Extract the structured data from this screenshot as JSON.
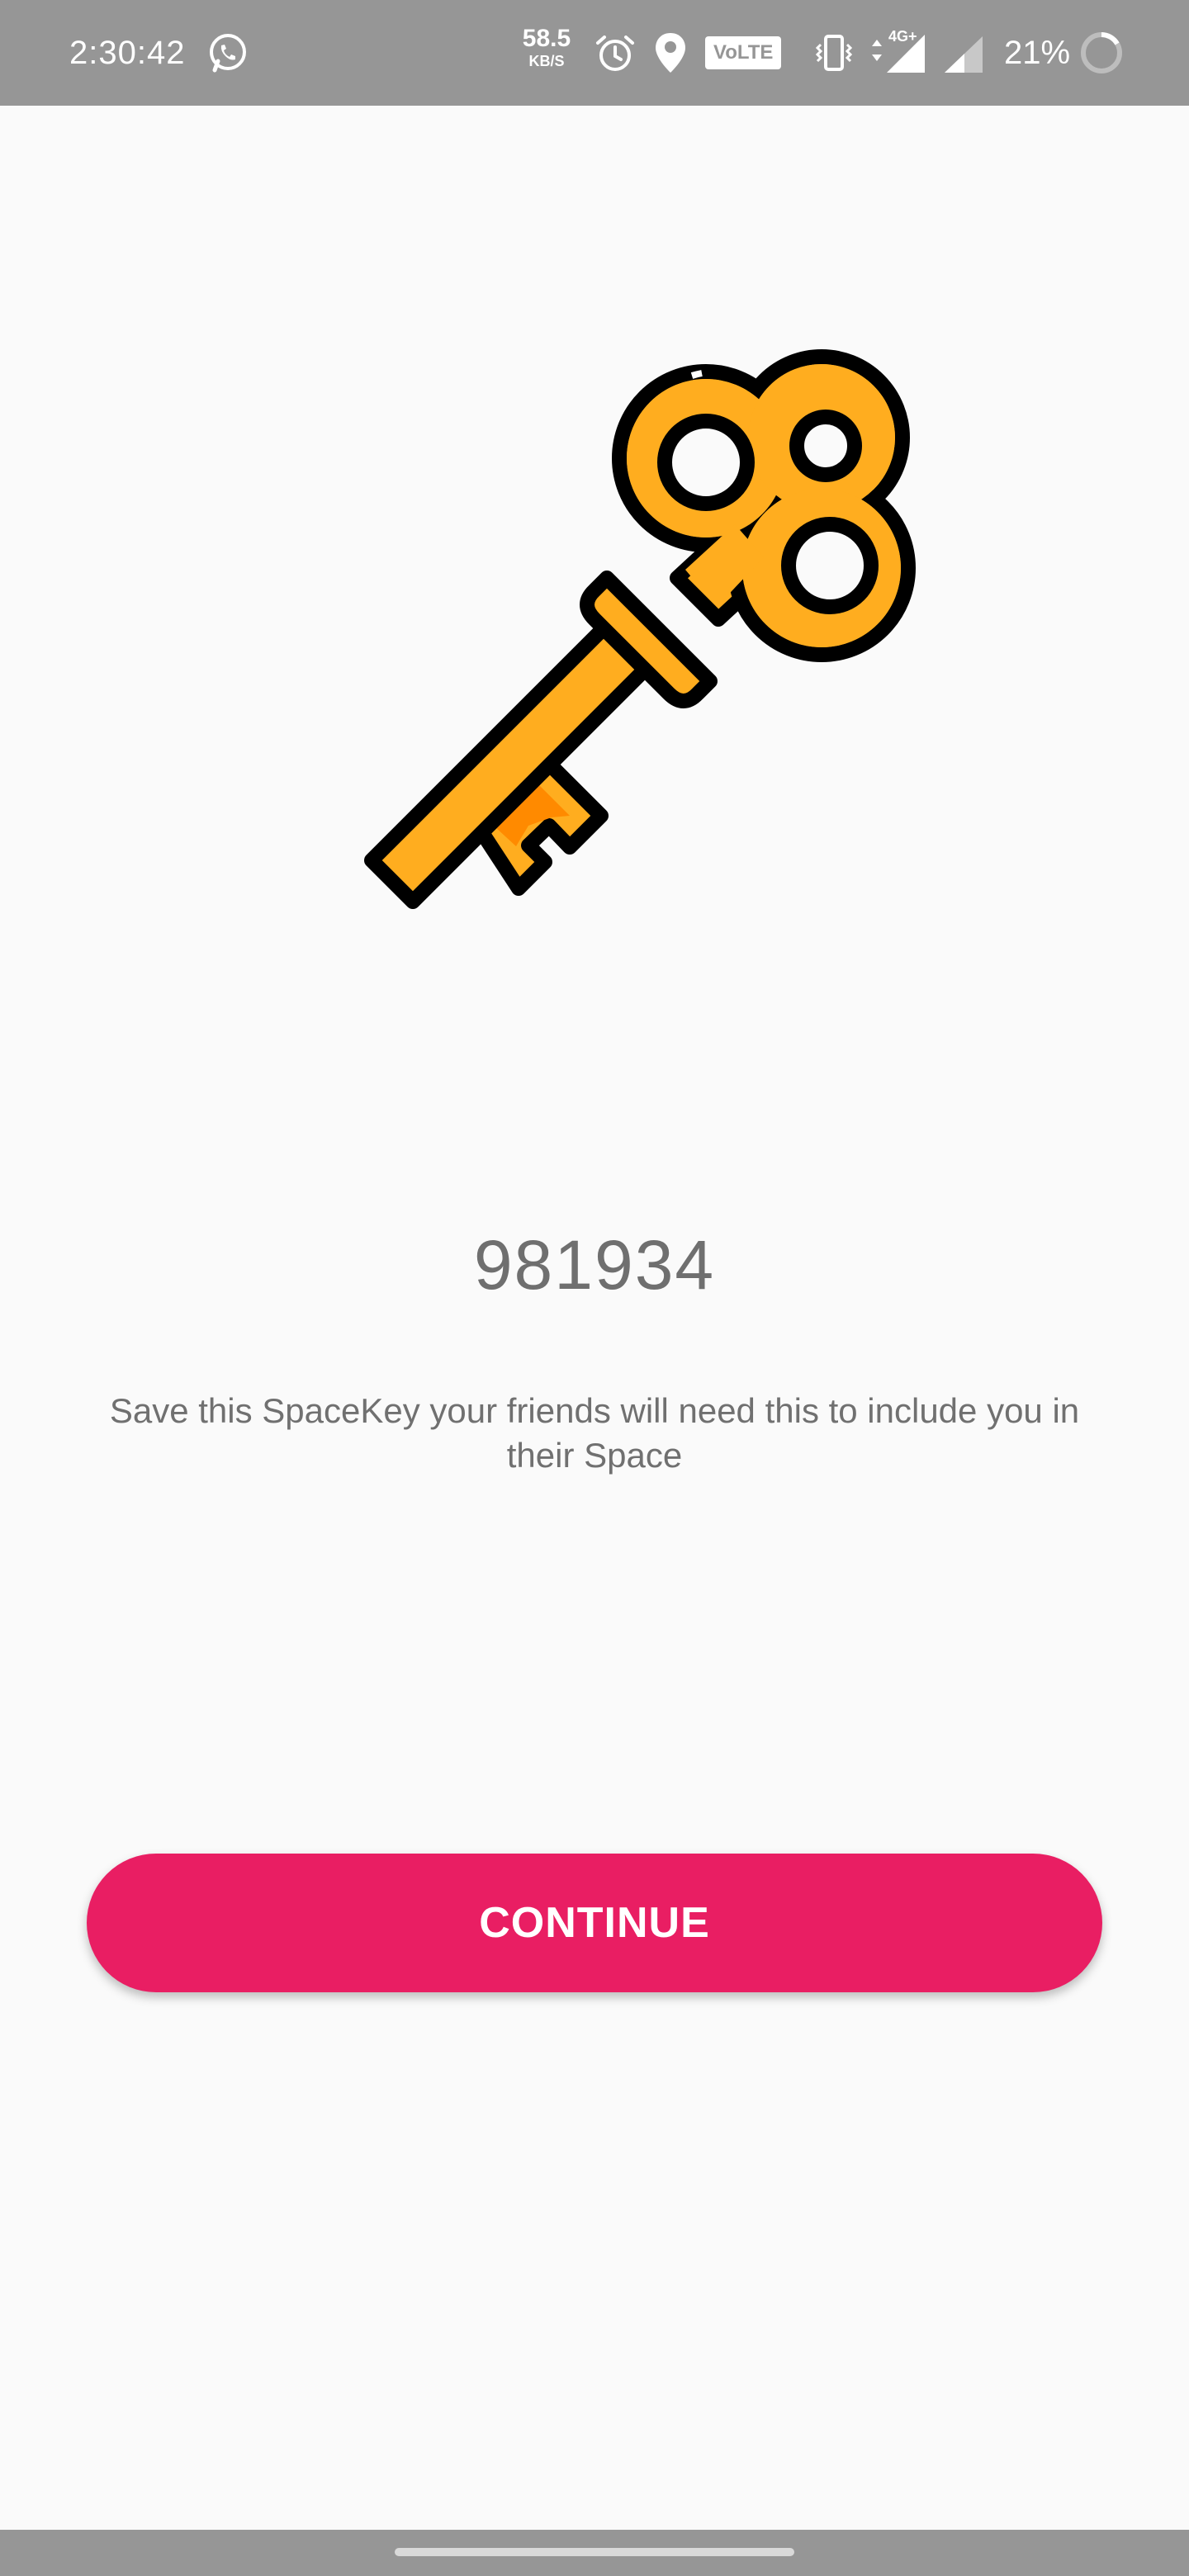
{
  "status_bar": {
    "time": "2:30:42",
    "net_speed_value": "58.5",
    "net_speed_unit": "KB/S",
    "volte_label": "VoLTE",
    "network_type": "4G+",
    "battery_percent": "21%",
    "icons": [
      "whatsapp-icon",
      "alarm-icon",
      "location-icon",
      "vibrate-icon",
      "signal-icon",
      "battery-icon"
    ]
  },
  "main": {
    "illustration_icon": "key-icon",
    "space_key": "981934",
    "instructions": "Save this SpaceKey your friends will need this to include you in their Space",
    "continue_label": "CONTINUE"
  },
  "colors": {
    "accent": "#e91e63",
    "key_body": "#ffad1f",
    "key_bit": "#ff8a00",
    "status_bar": "#969696",
    "background": "#fafafa",
    "text": "#6f6f6f"
  }
}
